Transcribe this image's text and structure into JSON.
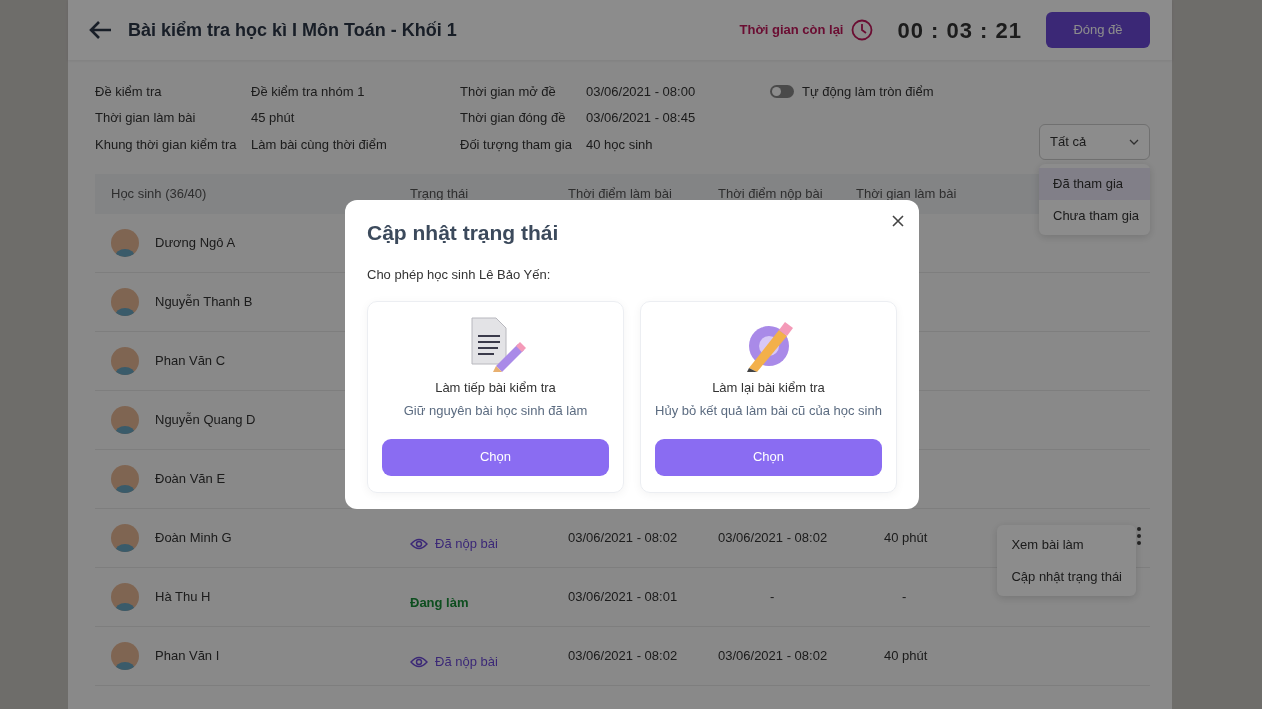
{
  "header": {
    "title": "Bài kiểm tra học kì I Môn Toán - Khối 1",
    "time_label": "Thời gian còn lại",
    "time": "00 : 03 : 21",
    "close_button": "Đóng đề"
  },
  "info_columns": [
    [
      {
        "label": "Đề kiểm tra",
        "value": "Đề kiểm tra nhóm 1"
      },
      {
        "label": "Thời gian làm bài",
        "value": "45 phút"
      },
      {
        "label": "Khung thời gian kiểm tra",
        "value": "Làm bài cùng thời điểm"
      }
    ],
    [
      {
        "label": "Thời gian mở đề",
        "value": "03/06/2021 - 08:00"
      },
      {
        "label": "Thời gian đóng đề",
        "value": "03/06/2021 - 08:45"
      },
      {
        "label": "Đối tượng tham gia",
        "value": "40 học sinh"
      }
    ]
  ],
  "auto_round": {
    "label": "Tự động làm tròn điểm",
    "on": false
  },
  "filter": {
    "value": "Tất cả",
    "options": [
      {
        "label": "Đã tham gia",
        "selected": true
      },
      {
        "label": "Chưa tham gia",
        "selected": false
      }
    ]
  },
  "table": {
    "columns": [
      "Học sinh (36/40)",
      "Trạng thái",
      "Thời điểm làm bài",
      "Thời điểm nộp bài",
      "Thời gian làm bài"
    ],
    "rows": [
      {
        "name": "Dương Ngô A"
      },
      {
        "name": "Nguyễn Thanh B"
      },
      {
        "name": "Phan Văn C"
      },
      {
        "name": "Nguyễn Quang D"
      },
      {
        "name": "Đoàn Văn E"
      },
      {
        "name": "Đoàn Minh G",
        "status": "Đã nộp bài",
        "kind": "submitted",
        "start": "03/06/2021 - 08:02",
        "submit": "03/06/2021 - 08:02",
        "duration": "40 phút",
        "menu": [
          "Xem bài làm",
          "Cập nhật trạng thái"
        ]
      },
      {
        "name": "Hà Thu H",
        "status": "Đang làm",
        "kind": "doing",
        "start": "03/06/2021 - 08:01",
        "submit": "-",
        "duration": "-"
      },
      {
        "name": "Phan Văn I",
        "status": "Đã nộp bài",
        "kind": "submitted",
        "start": "03/06/2021 - 08:02",
        "submit": "03/06/2021 - 08:02",
        "duration": "40 phút"
      }
    ]
  },
  "modal": {
    "title": "Cập nhật trạng thái",
    "prompt": "Cho phép học sinh Lê Bảo Yến:",
    "options": [
      {
        "kind": "continue",
        "title": "Làm tiếp bài kiểm tra",
        "subtitle": "Giữ nguyên bài học sinh đã làm",
        "button": "Chọn"
      },
      {
        "kind": "redo",
        "title": "Làm lại bài kiểm tra",
        "subtitle": "Hủy bỏ kết quả làm bài cũ của học sinh",
        "button": "Chọn"
      }
    ]
  }
}
